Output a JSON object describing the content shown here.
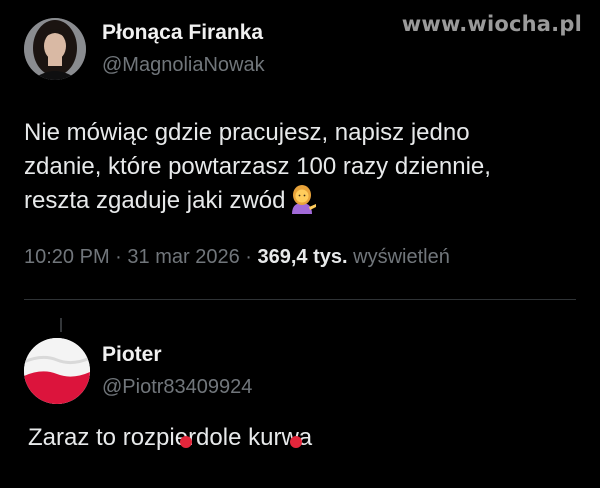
{
  "watermark": "www.wiocha.pl",
  "tweet": {
    "author_name": "Płonąca Firanka",
    "author_handle": "@MagnoliaNowak",
    "text_line1": "Nie mówiąc gdzie pracujesz, napisz jedno",
    "text_line2": "zdanie, które powtarzasz 100 razy dziennie,",
    "text_line3": "reszta zgaduje jaki zwód",
    "emoji": "woman-tipping-hand-emoji",
    "time": "10:20 PM",
    "date": "31 mar 2026",
    "separator": "·",
    "views_count": "369,4 tys.",
    "views_label": "wyświetleń"
  },
  "reply": {
    "author_name": "Pioter",
    "author_handle": "@Piotr83409924",
    "text": "Zaraz to rozpierdole kurwa",
    "avatar_flag": "polish-flag"
  },
  "colors": {
    "background": "#000000",
    "text_primary": "#e7e9ea",
    "text_secondary": "#71767b",
    "divider": "#2f3336",
    "censor_red": "#e3263b",
    "flag_red": "#dc143c"
  }
}
